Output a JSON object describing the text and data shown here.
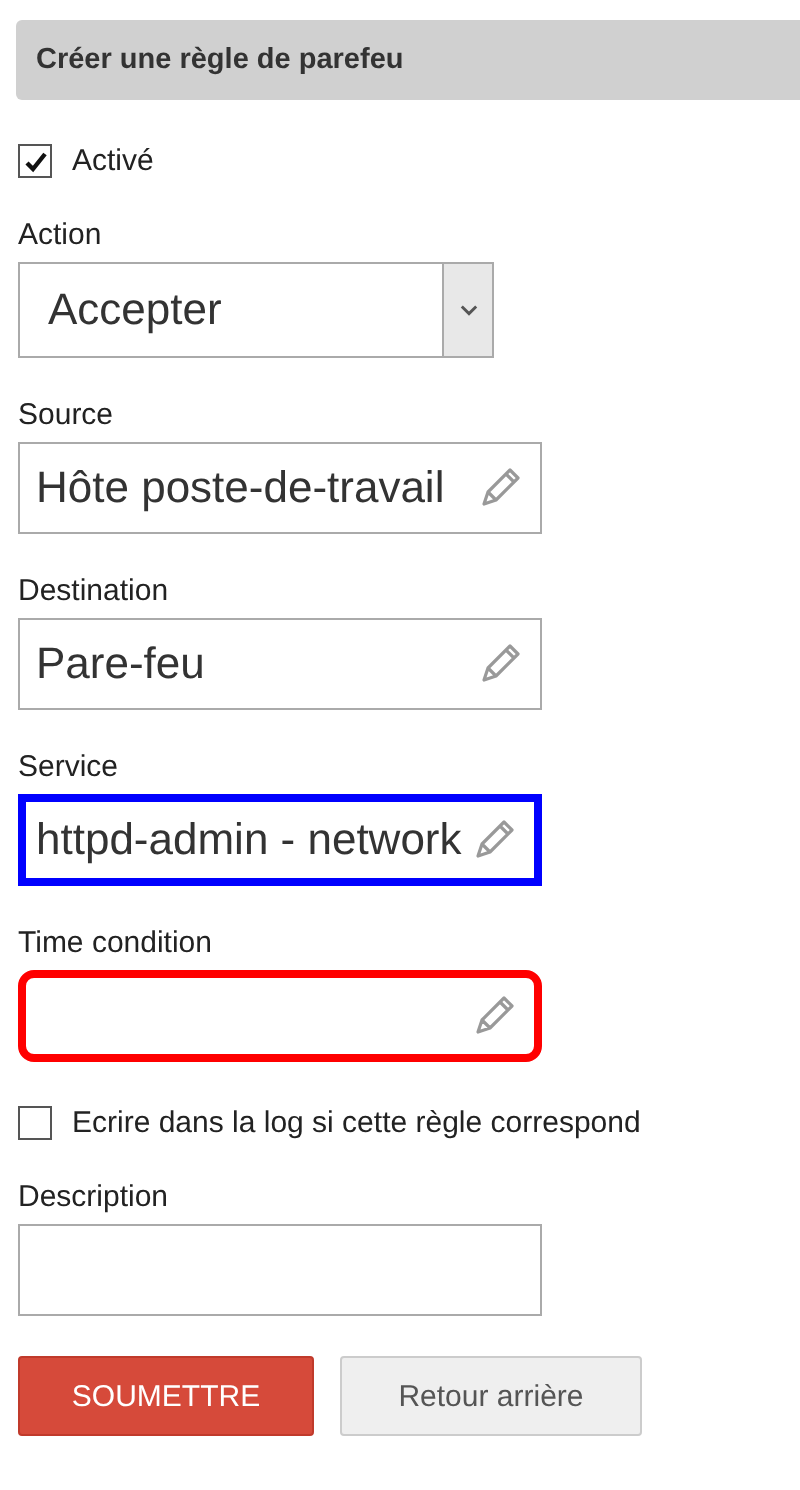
{
  "panel": {
    "title": "Créer une règle de parefeu"
  },
  "items": [
    {
      "kind": "checkbox",
      "label": "Activé",
      "checked": true
    },
    {
      "kind": "select",
      "label": "Action",
      "value": "Accepter"
    },
    {
      "kind": "picker",
      "label": "Source",
      "value": "Hôte poste-de-travail"
    },
    {
      "kind": "picker",
      "label": "Destination",
      "value": "Pare-feu"
    },
    {
      "kind": "picker",
      "label": "Service",
      "value": "httpd-admin - network",
      "color": "#0000ff"
    },
    {
      "kind": "picker",
      "label": "Time condition",
      "color": "#ff0000"
    },
    {
      "kind": "checkbox",
      "label": "Ecrire dans la log si cette règle correspond",
      "checked": false
    },
    {
      "kind": "text",
      "label": "Description"
    }
  ],
  "buttons": [
    {
      "label": "SOUMETTRE",
      "primary": true
    },
    {
      "label": "Retour arrière",
      "primary": false
    }
  ]
}
